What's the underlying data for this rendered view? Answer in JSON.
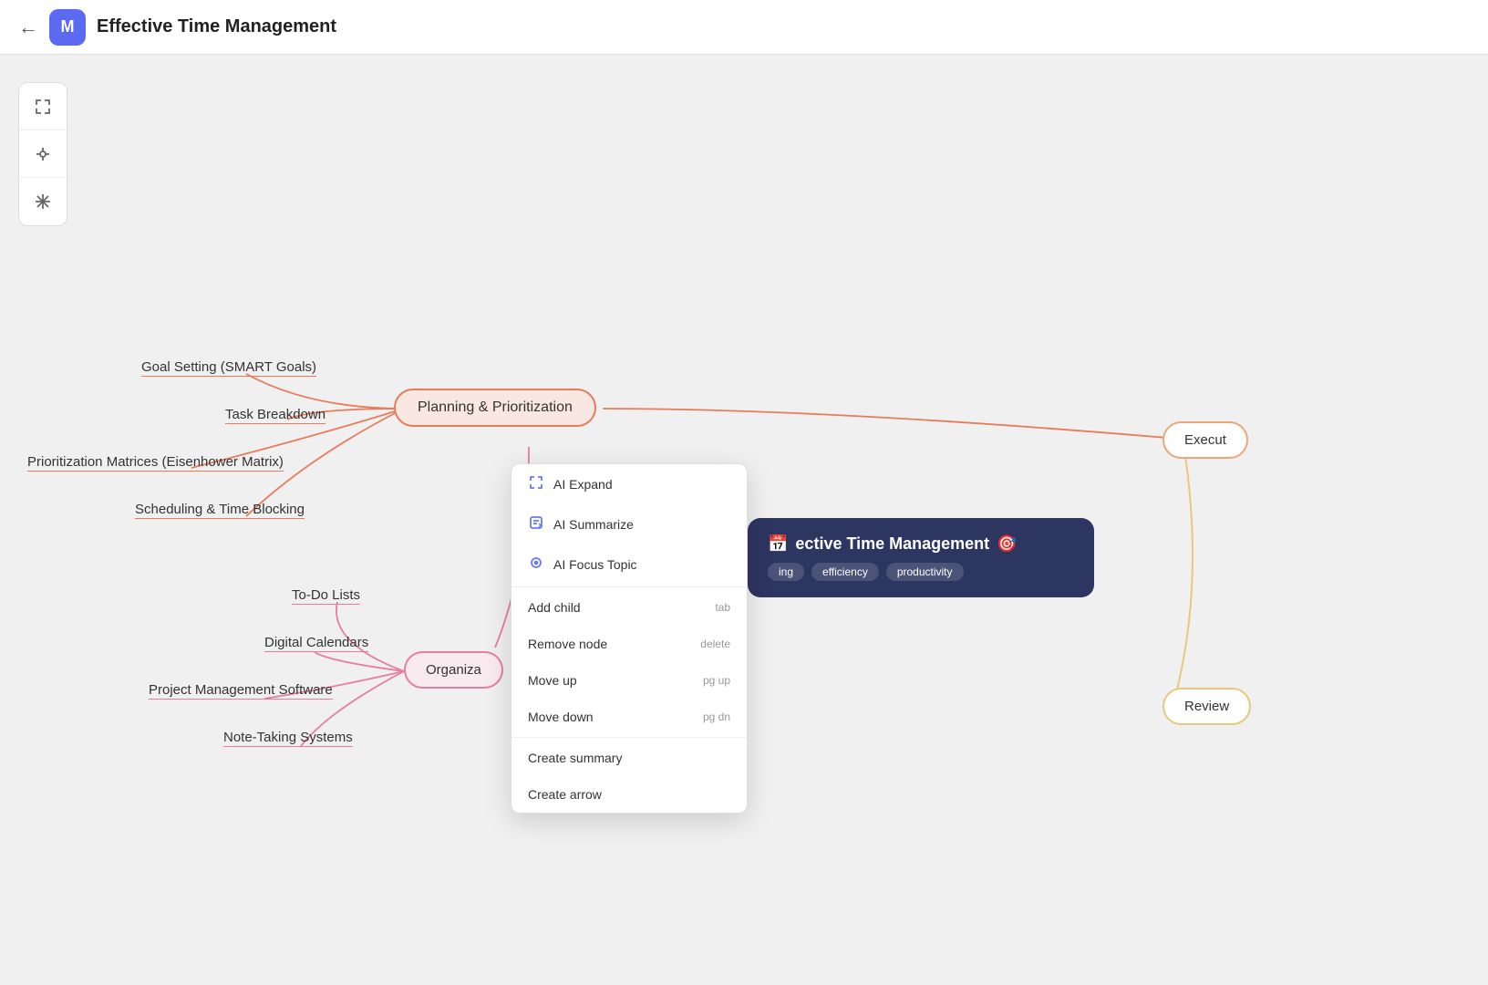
{
  "header": {
    "back_label": "←",
    "logo_text": "M",
    "title": "Effective Time Management"
  },
  "toolbar": {
    "buttons": [
      {
        "id": "fit-icon",
        "symbol": "⊞"
      },
      {
        "id": "share-icon",
        "symbol": "⇄"
      },
      {
        "id": "star-icon",
        "symbol": "✳"
      }
    ]
  },
  "mindmap": {
    "center_node": "Planning & Prioritization",
    "left_leaves_top": [
      "Goal Setting (SMART Goals)",
      "Task Breakdown",
      "Prioritization Matrices (Eisenhower Matrix)",
      "Scheduling & Time Blocking"
    ],
    "left_leaves_bottom": [
      "To-Do Lists",
      "Digital Calendars",
      "Project Management Software",
      "Note-Taking Systems"
    ],
    "organiza_label": "Organiza",
    "right_node_execution": "Execut",
    "right_node_review": "Review"
  },
  "info_card": {
    "title": "ective Time Management",
    "icon_calendar": "📅",
    "icon_target": "🎯",
    "tags": [
      "ing",
      "efficiency",
      "productivity"
    ]
  },
  "context_menu": {
    "items": [
      {
        "id": "ai-expand",
        "icon": "⤢",
        "label": "AI Expand",
        "shortcut": "",
        "has_icon": true,
        "ai": true
      },
      {
        "id": "ai-summarize",
        "icon": "✏",
        "label": "AI Summarize",
        "shortcut": "",
        "has_icon": true,
        "ai": true
      },
      {
        "id": "ai-focus",
        "icon": "○",
        "label": "AI Focus Topic",
        "shortcut": "",
        "has_icon": true,
        "ai": true
      },
      {
        "id": "add-child",
        "icon": "",
        "label": "Add child",
        "shortcut": "tab",
        "has_icon": false
      },
      {
        "id": "remove-node",
        "icon": "",
        "label": "Remove node",
        "shortcut": "delete",
        "has_icon": false
      },
      {
        "id": "move-up",
        "icon": "",
        "label": "Move up",
        "shortcut": "pg up",
        "has_icon": false
      },
      {
        "id": "move-down",
        "icon": "",
        "label": "Move down",
        "shortcut": "pg dn",
        "has_icon": false
      },
      {
        "id": "create-summary",
        "icon": "",
        "label": "Create summary",
        "shortcut": "",
        "has_icon": false
      },
      {
        "id": "create-arrow",
        "icon": "",
        "label": "Create arrow",
        "shortcut": "",
        "has_icon": false
      }
    ]
  }
}
